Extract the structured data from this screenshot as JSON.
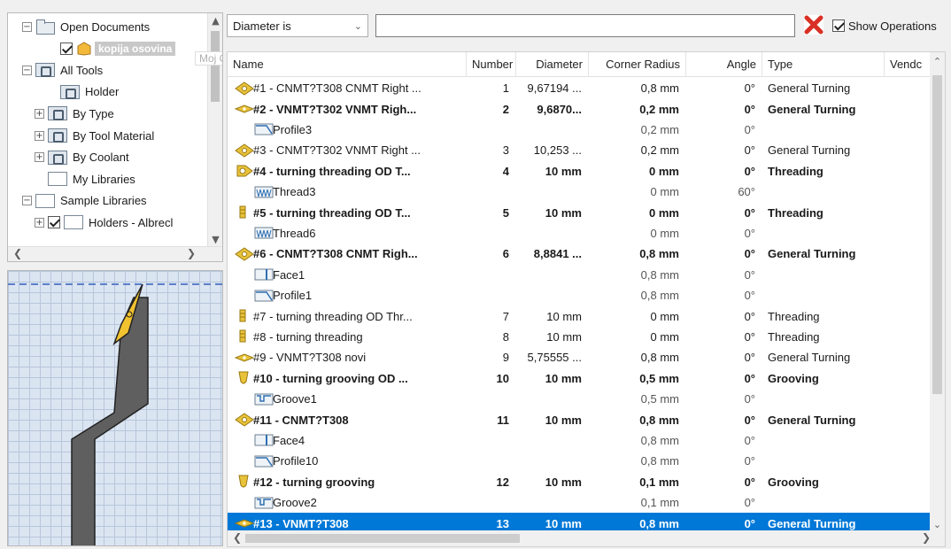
{
  "tree": {
    "items": [
      {
        "label": "Open Documents",
        "exp": "−",
        "icon": "folder",
        "indent": 0
      },
      {
        "label": "kopija osovina",
        "exp": "",
        "icon": "doc-checked",
        "indent": 2,
        "selected": true
      },
      {
        "label": "All Tools",
        "exp": "−",
        "icon": "tools",
        "indent": 0
      },
      {
        "label": "Holder",
        "exp": "",
        "icon": "tools",
        "indent": 2
      },
      {
        "label": "By Type",
        "exp": "+",
        "icon": "tools",
        "indent": 1
      },
      {
        "label": "By Tool Material",
        "exp": "+",
        "icon": "tools",
        "indent": 1
      },
      {
        "label": "By Coolant",
        "exp": "+",
        "icon": "tools",
        "indent": 1
      },
      {
        "label": "My Libraries",
        "exp": "",
        "icon": "library",
        "indent": 1
      },
      {
        "label": "Sample Libraries",
        "exp": "−",
        "icon": "library",
        "indent": 0
      },
      {
        "label": "Holders - Albrecl",
        "exp": "+",
        "icon": "lib-checked",
        "indent": 1
      }
    ],
    "tooltip": "Moj CAM tokarenje copy (simulacija sve)"
  },
  "filter": {
    "select_value": "Diameter is",
    "input_value": "",
    "show_operations_label": "Show Operations",
    "show_operations_checked": true
  },
  "colors": {
    "selection": "#0078d7",
    "insert_gold": "#e8c23a",
    "clear_red": "#d93025"
  },
  "table": {
    "columns": [
      {
        "key": "name",
        "label": "Name"
      },
      {
        "key": "number",
        "label": "Number"
      },
      {
        "key": "diameter",
        "label": "Diameter"
      },
      {
        "key": "radius",
        "label": "Corner Radius"
      },
      {
        "key": "angle",
        "label": "Angle"
      },
      {
        "key": "type",
        "label": "Type"
      },
      {
        "key": "vendor",
        "label": "Vendc"
      }
    ],
    "rows": [
      {
        "icon": "diamond-tool-icon",
        "name": "#1 - CNMT?T308 CNMT Right ...",
        "number": "1",
        "diameter": "9,67194 ...",
        "radius": "0,8 mm",
        "angle": "0°",
        "type": "General Turning",
        "bold": false,
        "child": false
      },
      {
        "icon": "vnmt-tool-icon",
        "name": "#2 - VNMT?T302 VNMT Righ...",
        "number": "2",
        "diameter": "9,6870...",
        "radius": "0,2 mm",
        "angle": "0°",
        "type": "General Turning",
        "bold": true,
        "child": false
      },
      {
        "icon": "profile-icon",
        "name": "Profile3",
        "number": "",
        "diameter": "",
        "radius": "0,2 mm",
        "angle": "0°",
        "type": "",
        "bold": false,
        "child": true
      },
      {
        "icon": "diamond-tool-icon",
        "name": "#3 - CNMT?T302 VNMT Right ...",
        "number": "3",
        "diameter": "10,253 ...",
        "radius": "0,2 mm",
        "angle": "0°",
        "type": "General Turning",
        "bold": false,
        "child": false
      },
      {
        "icon": "thread-tool-icon",
        "name": "#4 - turning threading OD T...",
        "number": "4",
        "diameter": "10 mm",
        "radius": "0 mm",
        "angle": "0°",
        "type": "Threading",
        "bold": true,
        "child": false
      },
      {
        "icon": "thread-op-icon",
        "name": "Thread3",
        "number": "",
        "diameter": "",
        "radius": "0 mm",
        "angle": "60°",
        "type": "",
        "bold": false,
        "child": true
      },
      {
        "icon": "bar-tool-icon",
        "name": "#5 - turning threading OD T...",
        "number": "5",
        "diameter": "10 mm",
        "radius": "0 mm",
        "angle": "0°",
        "type": "Threading",
        "bold": true,
        "child": false
      },
      {
        "icon": "thread-op-icon",
        "name": "Thread6",
        "number": "",
        "diameter": "",
        "radius": "0 mm",
        "angle": "0°",
        "type": "",
        "bold": false,
        "child": true
      },
      {
        "icon": "diamond-tool-icon",
        "name": "#6 - CNMT?T308 CNMT Righ...",
        "number": "6",
        "diameter": "8,8841 ...",
        "radius": "0,8 mm",
        "angle": "0°",
        "type": "General Turning",
        "bold": true,
        "child": false
      },
      {
        "icon": "face-icon",
        "name": "Face1",
        "number": "",
        "diameter": "",
        "radius": "0,8 mm",
        "angle": "0°",
        "type": "",
        "bold": false,
        "child": true
      },
      {
        "icon": "profile-icon",
        "name": "Profile1",
        "number": "",
        "diameter": "",
        "radius": "0,8 mm",
        "angle": "0°",
        "type": "",
        "bold": false,
        "child": true
      },
      {
        "icon": "bar-tool-icon",
        "name": "#7 - turning threading OD Thr...",
        "number": "7",
        "diameter": "10 mm",
        "radius": "0 mm",
        "angle": "0°",
        "type": "Threading",
        "bold": false,
        "child": false
      },
      {
        "icon": "bar-tool-icon",
        "name": "#8 - turning threading",
        "number": "8",
        "diameter": "10 mm",
        "radius": "0 mm",
        "angle": "0°",
        "type": "Threading",
        "bold": false,
        "child": false
      },
      {
        "icon": "vnmt-tool-icon",
        "name": "#9 - VNMT?T308 novi",
        "number": "9",
        "diameter": "5,75555 ...",
        "radius": "0,8 mm",
        "angle": "0°",
        "type": "General Turning",
        "bold": false,
        "child": false
      },
      {
        "icon": "groove-tool-icon",
        "name": "#10 - turning grooving OD ...",
        "number": "10",
        "diameter": "10 mm",
        "radius": "0,5 mm",
        "angle": "0°",
        "type": "Grooving",
        "bold": true,
        "child": false
      },
      {
        "icon": "groove-op-icon",
        "name": "Groove1",
        "number": "",
        "diameter": "",
        "radius": "0,5 mm",
        "angle": "0°",
        "type": "",
        "bold": false,
        "child": true
      },
      {
        "icon": "diamond-tool-icon",
        "name": "#11 - CNMT?T308",
        "number": "11",
        "diameter": "10 mm",
        "radius": "0,8 mm",
        "angle": "0°",
        "type": "General Turning",
        "bold": true,
        "child": false
      },
      {
        "icon": "face-icon",
        "name": "Face4",
        "number": "",
        "diameter": "",
        "radius": "0,8 mm",
        "angle": "0°",
        "type": "",
        "bold": false,
        "child": true
      },
      {
        "icon": "profile-icon",
        "name": "Profile10",
        "number": "",
        "diameter": "",
        "radius": "0,8 mm",
        "angle": "0°",
        "type": "",
        "bold": false,
        "child": true
      },
      {
        "icon": "groove-tool-icon",
        "name": "#12 - turning grooving",
        "number": "12",
        "diameter": "10 mm",
        "radius": "0,1 mm",
        "angle": "0°",
        "type": "Grooving",
        "bold": true,
        "child": false
      },
      {
        "icon": "groove-op-icon",
        "name": "Groove2",
        "number": "",
        "diameter": "",
        "radius": "0,1 mm",
        "angle": "0°",
        "type": "",
        "bold": false,
        "child": true
      },
      {
        "icon": "vnmt-tool-icon",
        "name": "#13 - VNMT?T308",
        "number": "13",
        "diameter": "10 mm",
        "radius": "0,8 mm",
        "angle": "0°",
        "type": "General Turning",
        "bold": true,
        "child": false,
        "selected": true
      }
    ]
  }
}
